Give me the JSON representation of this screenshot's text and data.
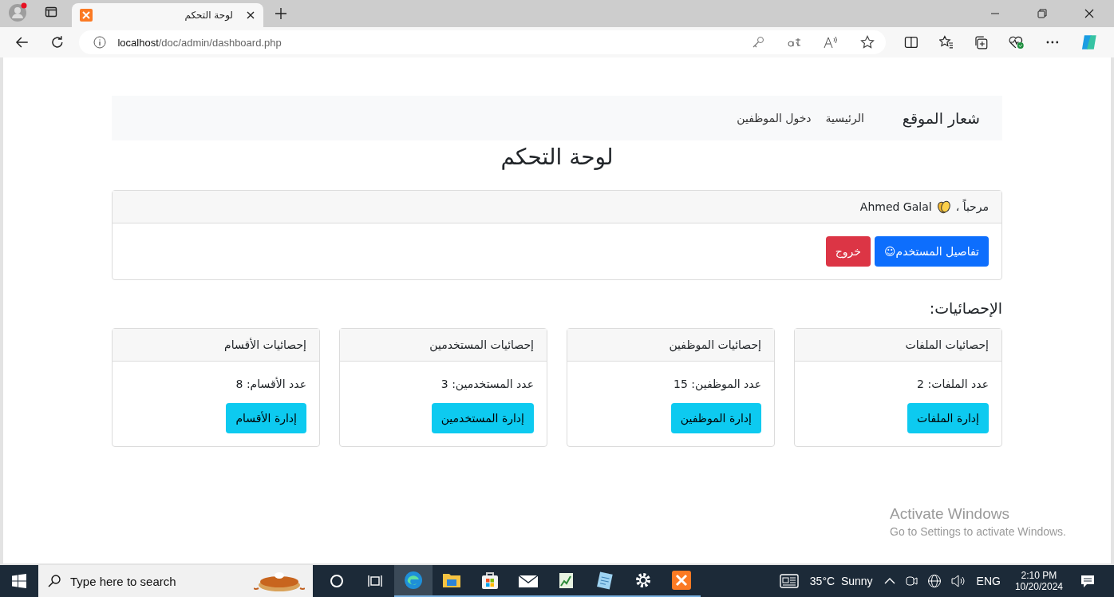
{
  "browser": {
    "tab_title": "لوحة التحكم",
    "url_host": "localhost",
    "url_path": "/doc/admin/dashboard.php"
  },
  "navbar": {
    "brand": "شعار الموقع",
    "links": [
      {
        "label": "الرئيسية"
      },
      {
        "label": "دخول الموظفين"
      }
    ]
  },
  "page_title": "لوحة التحكم",
  "welcome": {
    "greeting": "مرحباً ،",
    "user": "Ahmed Galal",
    "buttons": [
      {
        "label": "تفاصيل المستخدم☺",
        "kind": "primary"
      },
      {
        "label": "خروج",
        "kind": "danger"
      }
    ]
  },
  "stats_heading": "الإحصائيات:",
  "stats": [
    {
      "title": "إحصائيات الملفات",
      "count": "عدد الملفات: 2",
      "button": "إدارة الملفات"
    },
    {
      "title": "إحصائيات الموظفين",
      "count": "عدد الموظفين: 15",
      "button": "إدارة الموظفين"
    },
    {
      "title": "إحصائيات المستخدمين",
      "count": "عدد المستخدمين: 3",
      "button": "إدارة المستخدمين"
    },
    {
      "title": "إحصائيات الأقسام",
      "count": "عدد الأقسام: 8",
      "button": "إدارة الأقسام"
    }
  ],
  "activation": {
    "title": "Activate Windows",
    "hint": "Go to Settings to activate Windows."
  },
  "taskbar": {
    "search_placeholder": "Type here to search",
    "weather": "35°C  Sunny",
    "language": "ENG",
    "time": "2:10 PM",
    "date": "10/20/2024"
  }
}
